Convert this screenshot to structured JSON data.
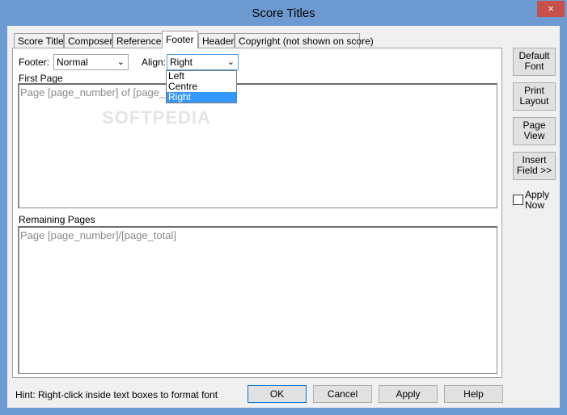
{
  "window": {
    "title": "Score Titles",
    "close_glyph": "×"
  },
  "tabs": [
    {
      "label": "Score Title"
    },
    {
      "label": "Composer"
    },
    {
      "label": "Reference"
    },
    {
      "label": "Footer"
    },
    {
      "label": "Header"
    },
    {
      "label": "Copyright (not shown on score)"
    }
  ],
  "active_tab": "Footer",
  "footer_field": {
    "label": "Footer:",
    "value": "Normal"
  },
  "align_field": {
    "label": "Align:",
    "value": "Right",
    "options": [
      "Left",
      "Centre",
      "Right"
    ],
    "selected": "Right"
  },
  "first_page": {
    "label": "First Page",
    "text": "Page [page_number] of [page_t"
  },
  "remaining_pages": {
    "label": "Remaining Pages",
    "text": "Page [page_number]/[page_total]"
  },
  "watermark": "SOFTPEDIA",
  "side_buttons": {
    "default_font": [
      "Default",
      "Font"
    ],
    "print_layout": [
      "Print",
      "Layout"
    ],
    "page_view": [
      "Page",
      "View"
    ],
    "insert_field": [
      "Insert",
      "Field >>"
    ]
  },
  "apply_now": {
    "label_line1": "Apply",
    "label_line2": "Now",
    "checked": false
  },
  "hint": "Hint:  Right-click inside text boxes to format font",
  "bottom_buttons": {
    "ok": "OK",
    "cancel": "Cancel",
    "apply": "Apply",
    "help": "Help"
  },
  "chevron_glyph": "⌄",
  "colors": {
    "titlebar": "#6d9bd1",
    "close": "#c7504b",
    "selection": "#3399ff"
  }
}
